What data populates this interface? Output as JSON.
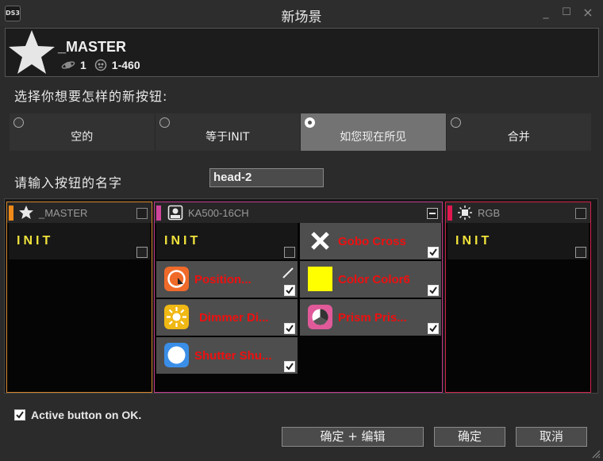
{
  "window": {
    "logo_text": "DS3",
    "title": "新场景",
    "controls": [
      "_",
      "☐",
      "×"
    ]
  },
  "header": {
    "name": "_MASTER",
    "worlds_count": "1",
    "fixtures_range": "1-460"
  },
  "question": "选择你想要怎样的新按钮:",
  "options": [
    {
      "label": "空的",
      "selected": false
    },
    {
      "label": "等于INIT",
      "selected": false
    },
    {
      "label": "如您现在所见",
      "selected": true
    },
    {
      "label": "合并",
      "selected": false
    }
  ],
  "name_field": {
    "label": "请输入按钮的名字",
    "value": "head-2"
  },
  "columns": [
    {
      "title": "_MASTER",
      "tag_color": "#f08a18",
      "border_color": "#d5832a",
      "icon": "star-icon",
      "init_label": "INIT"
    },
    {
      "title": "KA500-16CH",
      "tag_color": "#d0449c",
      "border_color": "#c43a8c",
      "icon": "fixture-icon",
      "init_label": "INIT",
      "attributes": [
        {
          "label": "Gobo Cross",
          "icon": "gobo-cross-icon",
          "checked": true
        },
        {
          "label": "Position...",
          "icon": "position-icon",
          "checked": true
        },
        {
          "label": "Color Color6",
          "icon": "color-swatch-icon",
          "checked": true
        },
        {
          "label": "Dimmer Di...",
          "icon": "dimmer-sun-icon",
          "checked": true
        },
        {
          "label": "Prism Pris...",
          "icon": "prism-icon",
          "checked": true
        },
        {
          "label": "Shutter Shu...",
          "icon": "shutter-icon",
          "checked": true
        }
      ]
    },
    {
      "title": "RGB",
      "tag_color": "#e01850",
      "border_color": "#d0224a",
      "icon": "rgb-light-icon",
      "init_label": "INIT"
    }
  ],
  "active_on_ok": {
    "label": "Active button on OK.",
    "checked": true
  },
  "buttons": {
    "confirm_edit": "确定 + 编辑",
    "confirm": "确定",
    "cancel": "取消"
  },
  "colors": {
    "init_text": "#f0e23c",
    "attr_text": "#ee1010",
    "selected_option": "#737373"
  }
}
